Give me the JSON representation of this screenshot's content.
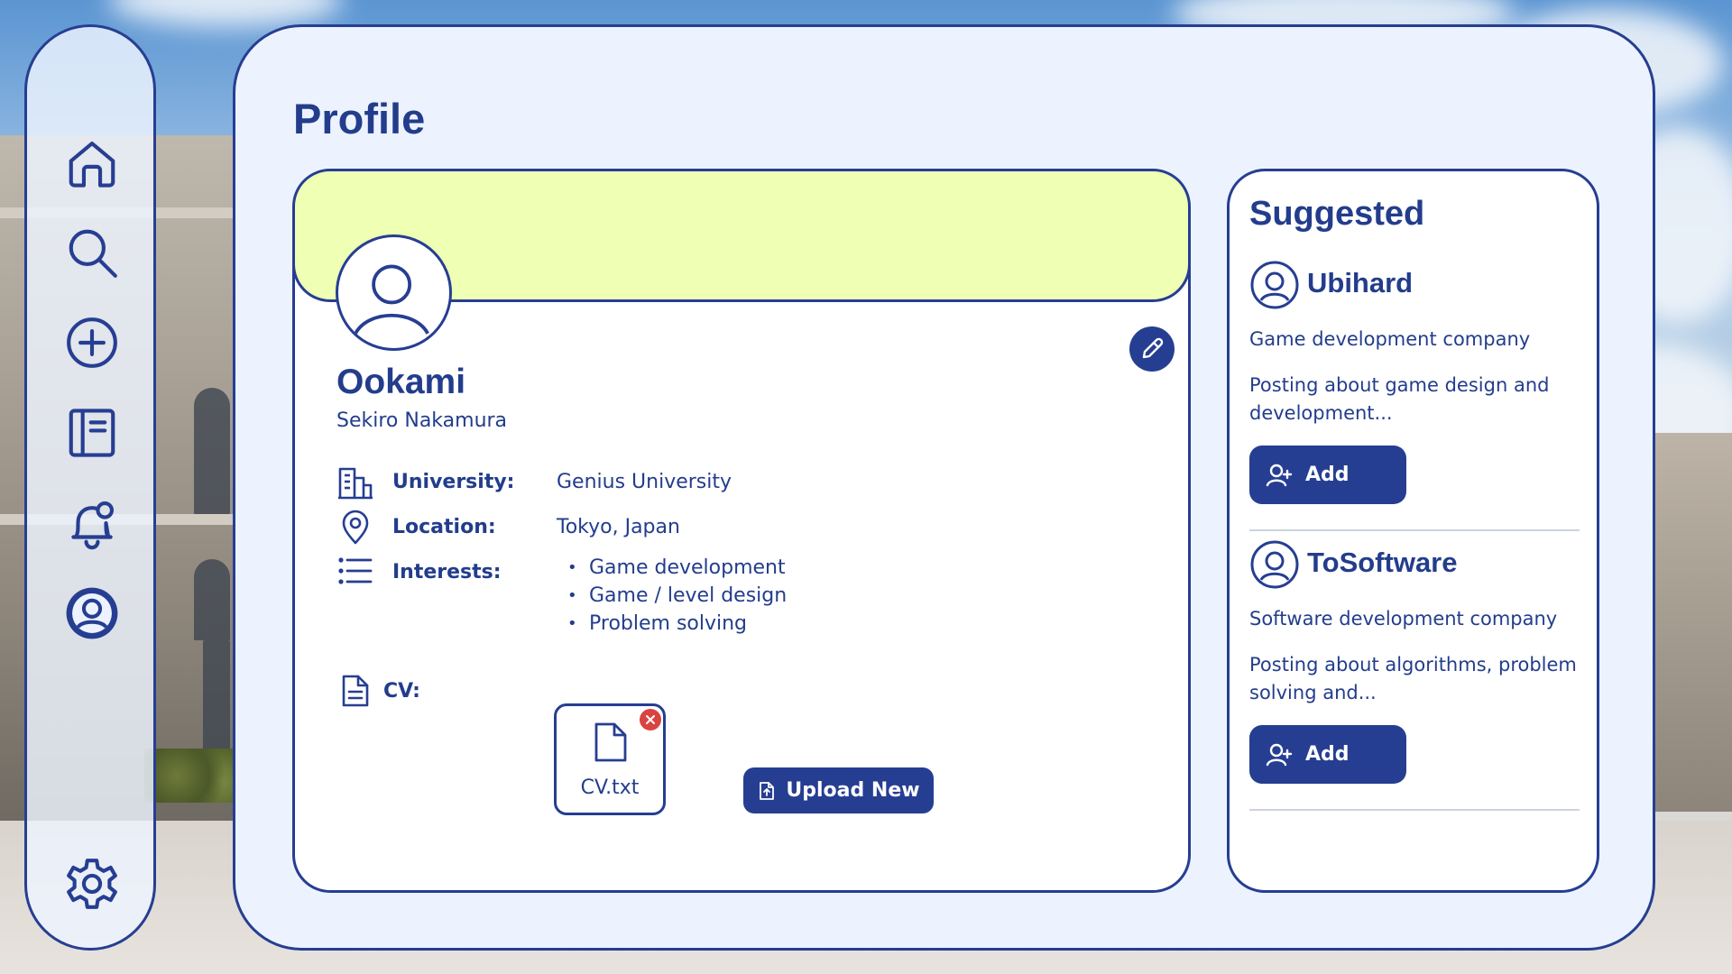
{
  "colors": {
    "primary": "#263e92",
    "text": "#233d8c",
    "banner": "#efffb4",
    "panel": "#ecf3fe",
    "card": "#ffffff",
    "remove": "#d94442"
  },
  "sidebar": {
    "items": [
      {
        "name": "home",
        "icon": "home-icon"
      },
      {
        "name": "search",
        "icon": "search-icon"
      },
      {
        "name": "create",
        "icon": "plus-circle-icon"
      },
      {
        "name": "feed",
        "icon": "notebook-icon"
      },
      {
        "name": "notifications",
        "icon": "bell-icon"
      },
      {
        "name": "profile",
        "icon": "user-circle-icon",
        "active": true
      },
      {
        "name": "settings",
        "icon": "gear-icon"
      }
    ]
  },
  "page": {
    "title": "Profile"
  },
  "profile": {
    "username": "Ookami",
    "full_name": "Sekiro Nakamura",
    "university_label": "University:",
    "university": "Genius University",
    "location_label": "Location:",
    "location": "Tokyo, Japan",
    "interests_label": "Interests:",
    "interests": [
      "Game development",
      "Game / level design",
      "Problem solving"
    ],
    "cv_label": "CV:",
    "cv_file": "CV.txt",
    "upload_label": "Upload New"
  },
  "suggested": {
    "title": "Suggested",
    "items": [
      {
        "name": "Ubihard",
        "description": "Game development company",
        "posting": "Posting about game design and development...",
        "add_label": "Add"
      },
      {
        "name": "ToSoftware",
        "description": "Software development company",
        "posting": "Posting about algorithms, problem solving and...",
        "add_label": "Add"
      }
    ]
  }
}
